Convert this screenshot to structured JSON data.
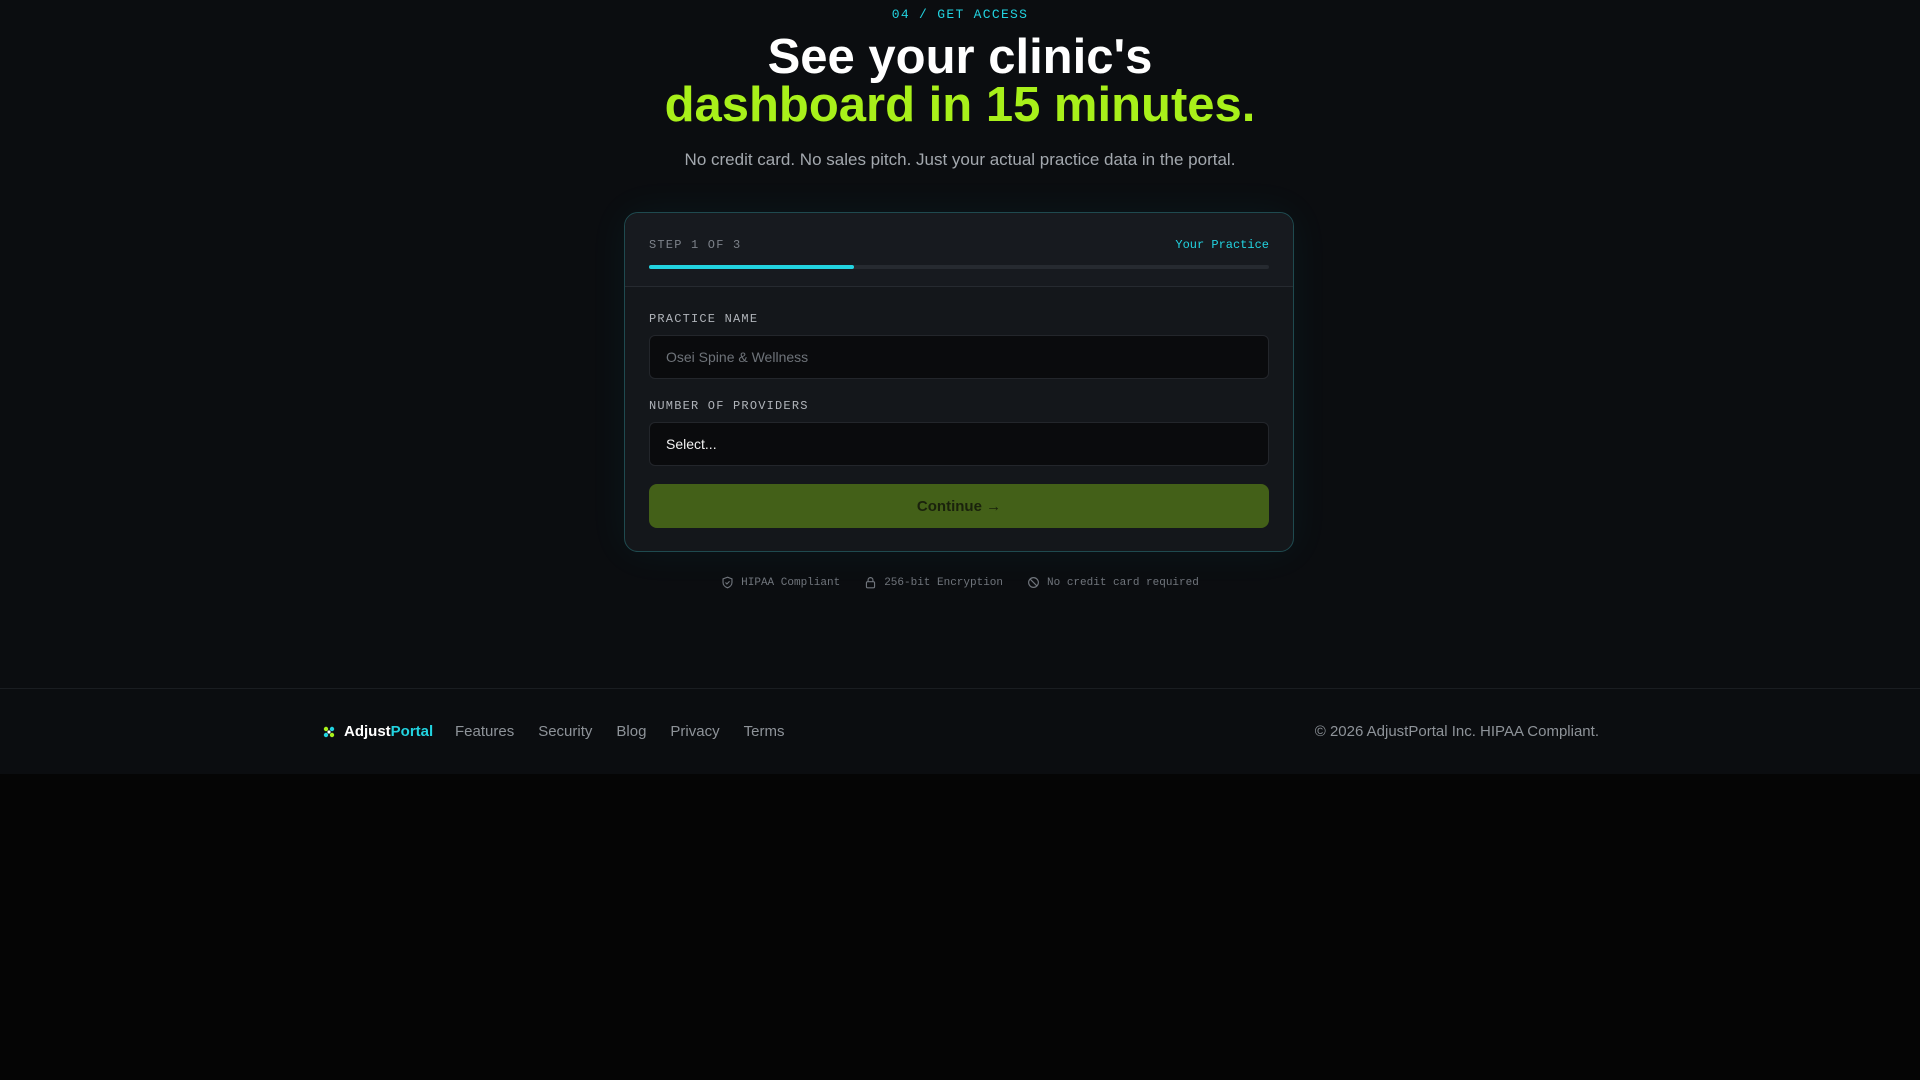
{
  "hero": {
    "eyebrow": "04 / GET ACCESS",
    "headline_line1": "See your clinic's",
    "headline_line2": "dashboard in 15 minutes.",
    "subhead": "No credit card. No sales pitch. Just your actual practice data in the portal."
  },
  "form": {
    "step_label": "STEP 1 OF 3",
    "step_name": "Your Practice",
    "progress_fraction": 0.33,
    "practice_name_label": "PRACTICE NAME",
    "practice_name_placeholder": "Osei Spine & Wellness",
    "providers_label": "NUMBER OF PROVIDERS",
    "providers_selected": "Select...",
    "continue_label": "Continue →"
  },
  "trust": [
    {
      "icon": "shield-icon",
      "label": "HIPAA Compliant"
    },
    {
      "icon": "lock-icon",
      "label": "256-bit Encryption"
    },
    {
      "icon": "no-card-icon",
      "label": "No credit card required"
    }
  ],
  "footer": {
    "brand_part1": "Adjust",
    "brand_part2": "Portal",
    "nav": [
      "Features",
      "Security",
      "Blog",
      "Privacy",
      "Terms"
    ],
    "copyright": "© 2026 AdjustPortal Inc. HIPAA Compliant."
  },
  "colors": {
    "accent_cyan": "#22d3e0",
    "accent_lime": "#a8f01a",
    "button_bg": "#436018",
    "background": "#0b0d10"
  }
}
